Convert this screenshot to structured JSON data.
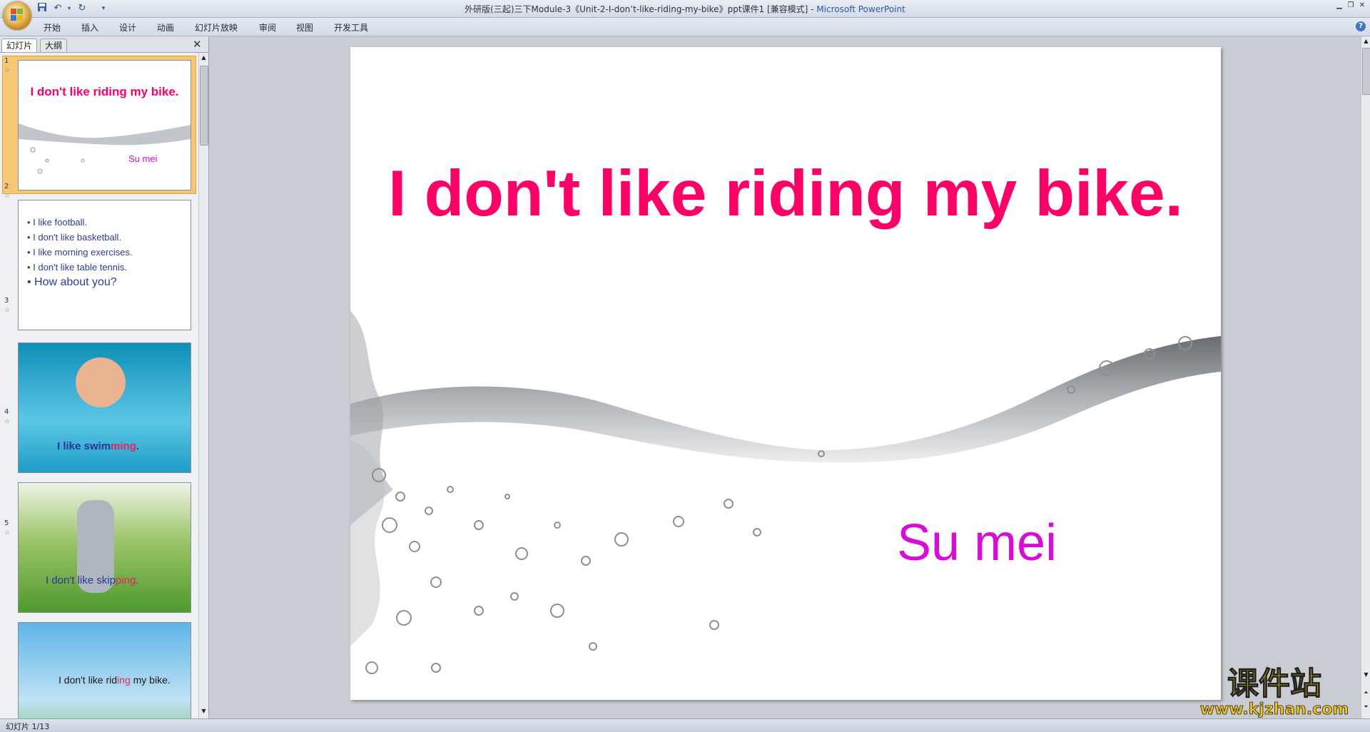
{
  "window": {
    "title": "外研版(三起)三下Module-3《Unit-2-I-don’t-like-riding-my-bike》ppt课件1 [兼容模式]",
    "app_name": "Microsoft PowerPoint",
    "title_sep": " - "
  },
  "ribbon": {
    "tabs": [
      "开始",
      "插入",
      "设计",
      "动画",
      "幻灯片放映",
      "审阅",
      "视图",
      "开发工具"
    ]
  },
  "pane": {
    "tabs": [
      "幻灯片",
      "大纲"
    ],
    "close": "✕"
  },
  "thumbnails": [
    {
      "num": "1",
      "title": "I don't like riding my bike.",
      "sub": "Su mei"
    },
    {
      "num": "2",
      "bullets": [
        "I like football.",
        "I don't like basketball.",
        "I like morning exercises.",
        "I don't like table tennis.",
        "How about you?"
      ]
    },
    {
      "num": "3",
      "caption_a": "I like swim",
      "caption_b": "ming",
      "caption_c": "."
    },
    {
      "num": "4",
      "caption_a": "I don't like skip",
      "caption_b": "ping",
      "caption_c": "."
    },
    {
      "num": "5",
      "caption_a": "I don't like rid",
      "caption_b": "ing",
      "caption_c": " my bike."
    }
  ],
  "slide": {
    "title": "I don't like riding my bike.",
    "subtitle": "Su mei",
    "title_color": "#ff0066",
    "subtitle_color": "#d80cd8"
  },
  "status": {
    "slide_counter": "幻灯片 1/13"
  },
  "watermark": {
    "cn": "课件站",
    "url": "www.kjzhan.com"
  }
}
